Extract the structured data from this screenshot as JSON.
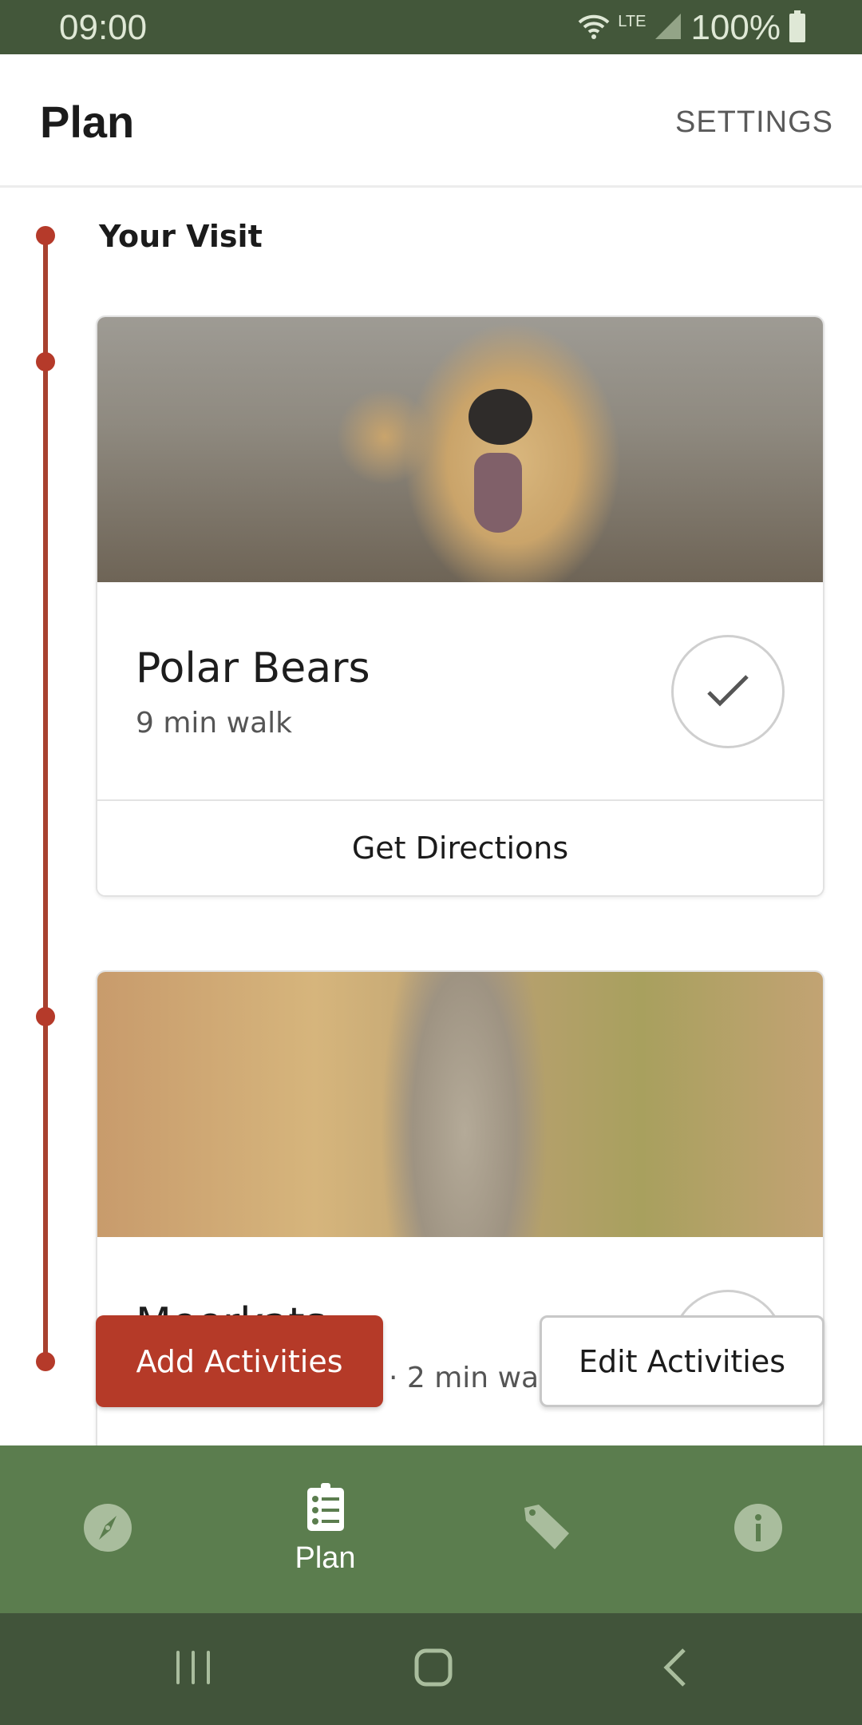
{
  "status_bar": {
    "time": "09:00",
    "network": "LTE",
    "battery": "100%",
    "icons": [
      "wifi-icon",
      "signal-icon",
      "battery-icon"
    ]
  },
  "app_bar": {
    "title": "Plan",
    "settings_label": "SETTINGS"
  },
  "visit": {
    "section_title": "Your Visit",
    "activities": [
      {
        "name": "Polar Bears",
        "walk_time": "9 min walk",
        "image": "polar-bear-photo",
        "action_label": "Get Directions",
        "check_icon": "checkmark-icon"
      },
      {
        "name": "Meerkats",
        "walk_time": "· 2 min walk",
        "image": "meerkat-photo"
      }
    ]
  },
  "actions": {
    "add_label": "Add Activities",
    "edit_label": "Edit Activities"
  },
  "bottom_nav": {
    "items": [
      {
        "icon": "compass-icon",
        "label": ""
      },
      {
        "icon": "clipboard-list-icon",
        "label": "Plan",
        "active": true
      },
      {
        "icon": "tag-icon",
        "label": ""
      },
      {
        "icon": "info-icon",
        "label": ""
      }
    ]
  },
  "system_nav": {
    "buttons": [
      "recent-apps",
      "home",
      "back"
    ]
  },
  "colors": {
    "status_bar": "#43573a",
    "accent_red": "#b53a28",
    "nav_green": "#5b7d4e",
    "system_nav": "#41543a"
  }
}
